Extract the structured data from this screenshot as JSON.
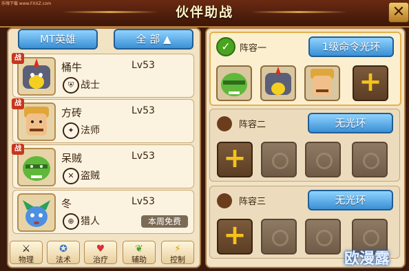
{
  "site_text": "乐嗨下载 www.FXXZ.com",
  "title": "伙伴助战",
  "close_label": "✕",
  "left": {
    "type_button": "MT英雄",
    "filter_button": "全 部 ▲",
    "heroes": [
      {
        "name": "桶牛",
        "level": "Lv53",
        "role": "战士",
        "badge": "战",
        "role_icon": "shield-icon",
        "free": ""
      },
      {
        "name": "方砖",
        "level": "Lv53",
        "role": "法师",
        "badge": "战",
        "role_icon": "wand-icon",
        "free": ""
      },
      {
        "name": "呆贼",
        "level": "Lv53",
        "role": "盗贼",
        "badge": "战",
        "role_icon": "dagger-icon",
        "free": ""
      },
      {
        "name": "冬",
        "level": "Lv53",
        "role": "猎人",
        "badge": "",
        "role_icon": "crosshair-icon",
        "free": "本周免费"
      }
    ],
    "filters": [
      {
        "label": "物理",
        "icon": "sword-icon"
      },
      {
        "label": "法术",
        "icon": "staff-icon"
      },
      {
        "label": "治疗",
        "icon": "heart-icon"
      },
      {
        "label": "辅助",
        "icon": "leaf-icon"
      },
      {
        "label": "控制",
        "icon": "lightning-icon"
      }
    ]
  },
  "teams": [
    {
      "name": "阵容一",
      "aura": "1级命令光环",
      "selected": true
    },
    {
      "name": "阵容二",
      "aura": "无光环",
      "selected": false
    },
    {
      "name": "阵容三",
      "aura": "无光环",
      "selected": false
    }
  ],
  "watermark": "欧漫露"
}
